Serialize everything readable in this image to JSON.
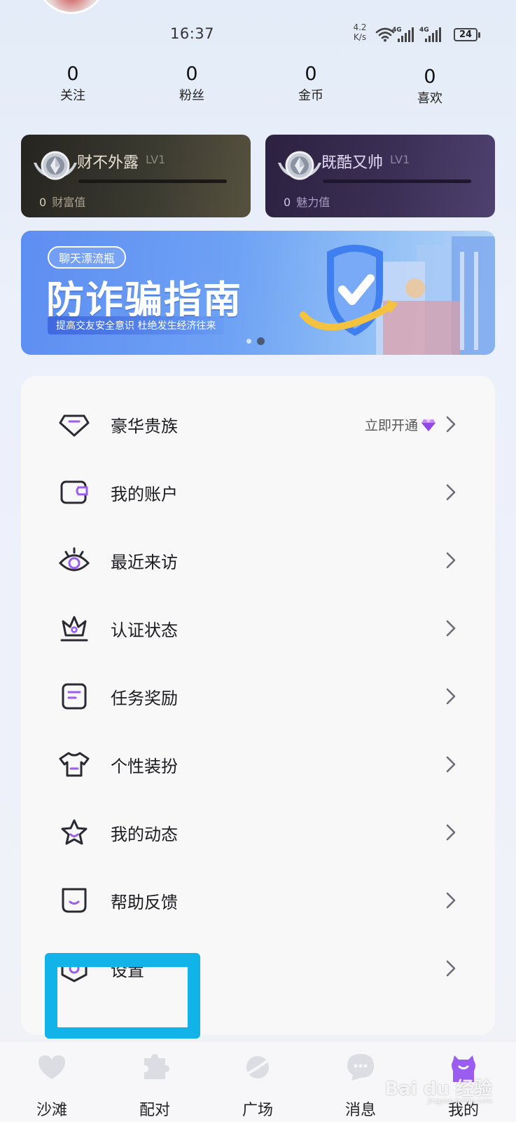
{
  "status_bar": {
    "time": "16:37",
    "net_speed_value": "4.2",
    "net_speed_unit": "K/s",
    "signal_1_label": "4G",
    "signal_2_label": "4G",
    "battery": "24"
  },
  "stats": [
    {
      "value": "0",
      "label": "关注"
    },
    {
      "value": "0",
      "label": "粉丝"
    },
    {
      "value": "0",
      "label": "金币"
    },
    {
      "value": "0",
      "label": "喜欢"
    }
  ],
  "level_cards": {
    "wealth": {
      "title": "财不外露",
      "level": "LV1",
      "value": "0",
      "value_label": "财富值",
      "icon": "silver-medal-icon"
    },
    "charm": {
      "title": "既酷又帅",
      "level": "LV1",
      "value": "0",
      "value_label": "魅力值",
      "icon": "silver-medal-icon"
    }
  },
  "banner": {
    "tag": "聊天漂流瓶",
    "title": "防诈骗指南",
    "subtitle": "提高交友安全意识 杜绝发生经济往来",
    "page_count": 2,
    "active_page": 2
  },
  "menu": {
    "items": [
      {
        "label": "豪华贵族",
        "icon": "diamond-icon",
        "extra": "立即开通"
      },
      {
        "label": "我的账户",
        "icon": "wallet-icon"
      },
      {
        "label": "最近来访",
        "icon": "eye-icon"
      },
      {
        "label": "认证状态",
        "icon": "crown-icon"
      },
      {
        "label": "任务奖励",
        "icon": "task-icon"
      },
      {
        "label": "个性装扮",
        "icon": "tshirt-icon"
      },
      {
        "label": "我的动态",
        "icon": "star-icon"
      },
      {
        "label": "帮助反馈",
        "icon": "feedback-icon"
      },
      {
        "label": "设置",
        "icon": "settings-icon"
      }
    ]
  },
  "tabbar": {
    "tabs": [
      {
        "label": "沙滩",
        "icon": "heart-icon"
      },
      {
        "label": "配对",
        "icon": "puzzle-icon"
      },
      {
        "label": "广场",
        "icon": "planet-icon"
      },
      {
        "label": "消息",
        "icon": "chat-icon"
      },
      {
        "label": "我的",
        "icon": "user-icon"
      }
    ],
    "active": "我的"
  },
  "watermark": {
    "text": "Bai du 经验",
    "sub": "jingyan.baidu.com"
  },
  "colors": {
    "accent": "#9b5cf0",
    "highlight": "#11b3e8",
    "icon_stroke": "#2a2a33"
  }
}
